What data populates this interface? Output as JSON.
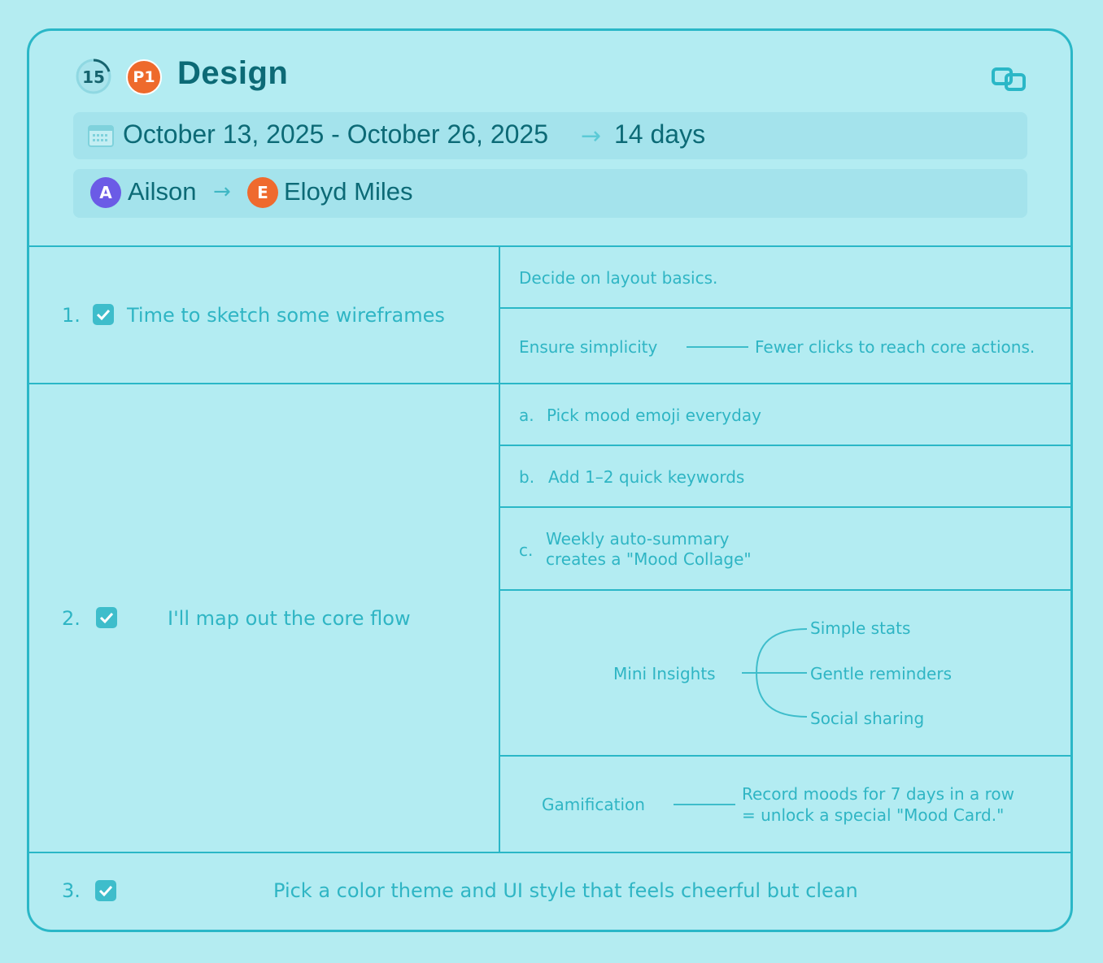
{
  "header": {
    "counter": "15",
    "priority": "P1",
    "title": "Design",
    "date_range": "October 13, 2025 - October 26, 2025",
    "duration": "14 days",
    "from_initial": "A",
    "from_name": "Ailson",
    "to_initial": "E",
    "to_name": "Eloyd Miles"
  },
  "tasks": [
    {
      "number": "1.",
      "label": "Time to sketch some wireframes",
      "notes": {
        "line1": "Decide on layout basics.",
        "simplicity_key": "Ensure simplicity",
        "simplicity_value": "Fewer clicks to reach core actions."
      }
    },
    {
      "number": "2.",
      "label": "I'll map out the core flow",
      "steps": [
        {
          "marker": "a.",
          "text": "Pick mood emoji everyday"
        },
        {
          "marker": "b.",
          "text": "Add 1–2 quick keywords"
        },
        {
          "marker": "c.",
          "line1": "Weekly auto-summary",
          "line2": "creates a \"Mood Collage\""
        }
      ],
      "insights": {
        "root": "Mini Insights",
        "branches": [
          "Simple stats",
          "Gentle reminders",
          "Social sharing"
        ]
      },
      "gamification": {
        "key": "Gamification",
        "line1": "Record moods for 7 days in a row",
        "line2": "= unlock a special \"Mood Card.\""
      }
    },
    {
      "number": "3.",
      "label": "Pick a color theme and UI style that feels cheerful but clean"
    }
  ],
  "colors": {
    "background": "#b4ecf1",
    "accent": "#2ab7c7",
    "title": "#0c6a76",
    "priority": "#ee6a2c",
    "avatar_a": "#6b5be6",
    "avatar_e": "#ef6a2e"
  }
}
